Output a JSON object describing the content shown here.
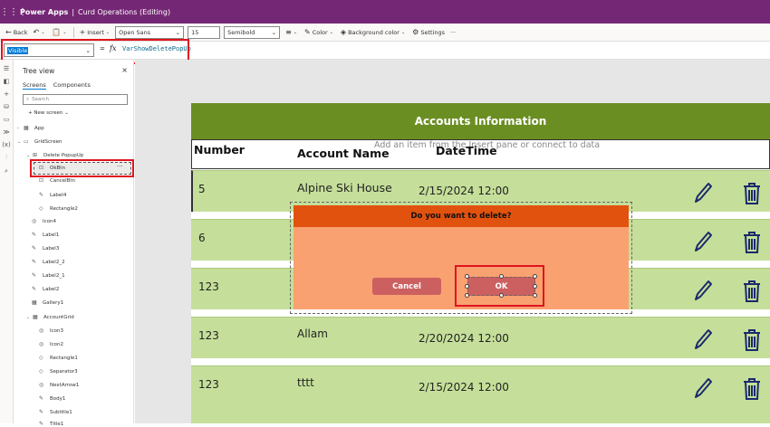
{
  "titlebar": {
    "waffle": "⋮⋮⋮",
    "app": "Power Apps",
    "separator": "|",
    "doc": "Curd Operations (Editing)"
  },
  "toolbar": {
    "back": "Back",
    "insert": "Insert",
    "font": "Open Sans",
    "font_size": "15",
    "weight": "Semibold",
    "color": "Color",
    "background": "Background color",
    "settings": "Settings",
    "more": "···"
  },
  "formula": {
    "property": "Visible",
    "equals": "=",
    "fx": "fx",
    "expression": "VarShowDeletePopUp"
  },
  "tree": {
    "title": "Tree view",
    "tabs": [
      "Screens",
      "Components"
    ],
    "search_placeholder": "Search",
    "new_screen": "New screen",
    "nodes": [
      "App",
      "GridScreen",
      "Delete PopupUp",
      "OkBtn",
      "CancelBtn",
      "Label4",
      "Rectangle2",
      "Icon4",
      "Label1",
      "Label3",
      "Label2_2",
      "Label2_1",
      "Label2",
      "Gallery1",
      "AccountGrid",
      "Icon3",
      "Icon2",
      "Rectangle1",
      "Separator3",
      "NextArrow1",
      "Body1",
      "Subtitle1",
      "Title1"
    ],
    "more": "···"
  },
  "canvas": {
    "header_title": "Accounts Information",
    "hint": "Add an item from the Insert pane or connect to data",
    "columns": [
      "Number",
      "Account Name",
      "DateTime"
    ],
    "rows": [
      {
        "number": "5",
        "name": "Alpine Ski House",
        "datetime": "2/15/2024 12:00"
      },
      {
        "number": "6",
        "name": "",
        "datetime": ""
      },
      {
        "number": "123",
        "name": "",
        "datetime": ""
      },
      {
        "number": "123",
        "name": "Allam",
        "datetime": "2/20/2024 12:00"
      },
      {
        "number": "123",
        "name": "tttt",
        "datetime": "2/15/2024 12:00"
      }
    ]
  },
  "popup": {
    "title": "Do you want to delete?",
    "cancel": "Cancel",
    "ok": "OK"
  },
  "colors": {
    "titlebar": "#742774",
    "header": "#6b8e23",
    "row": "#c5df9a",
    "popup": "#f9a171",
    "popup_title": "#e2520f",
    "button": "#cc6060",
    "highlight": "#e0141e"
  }
}
